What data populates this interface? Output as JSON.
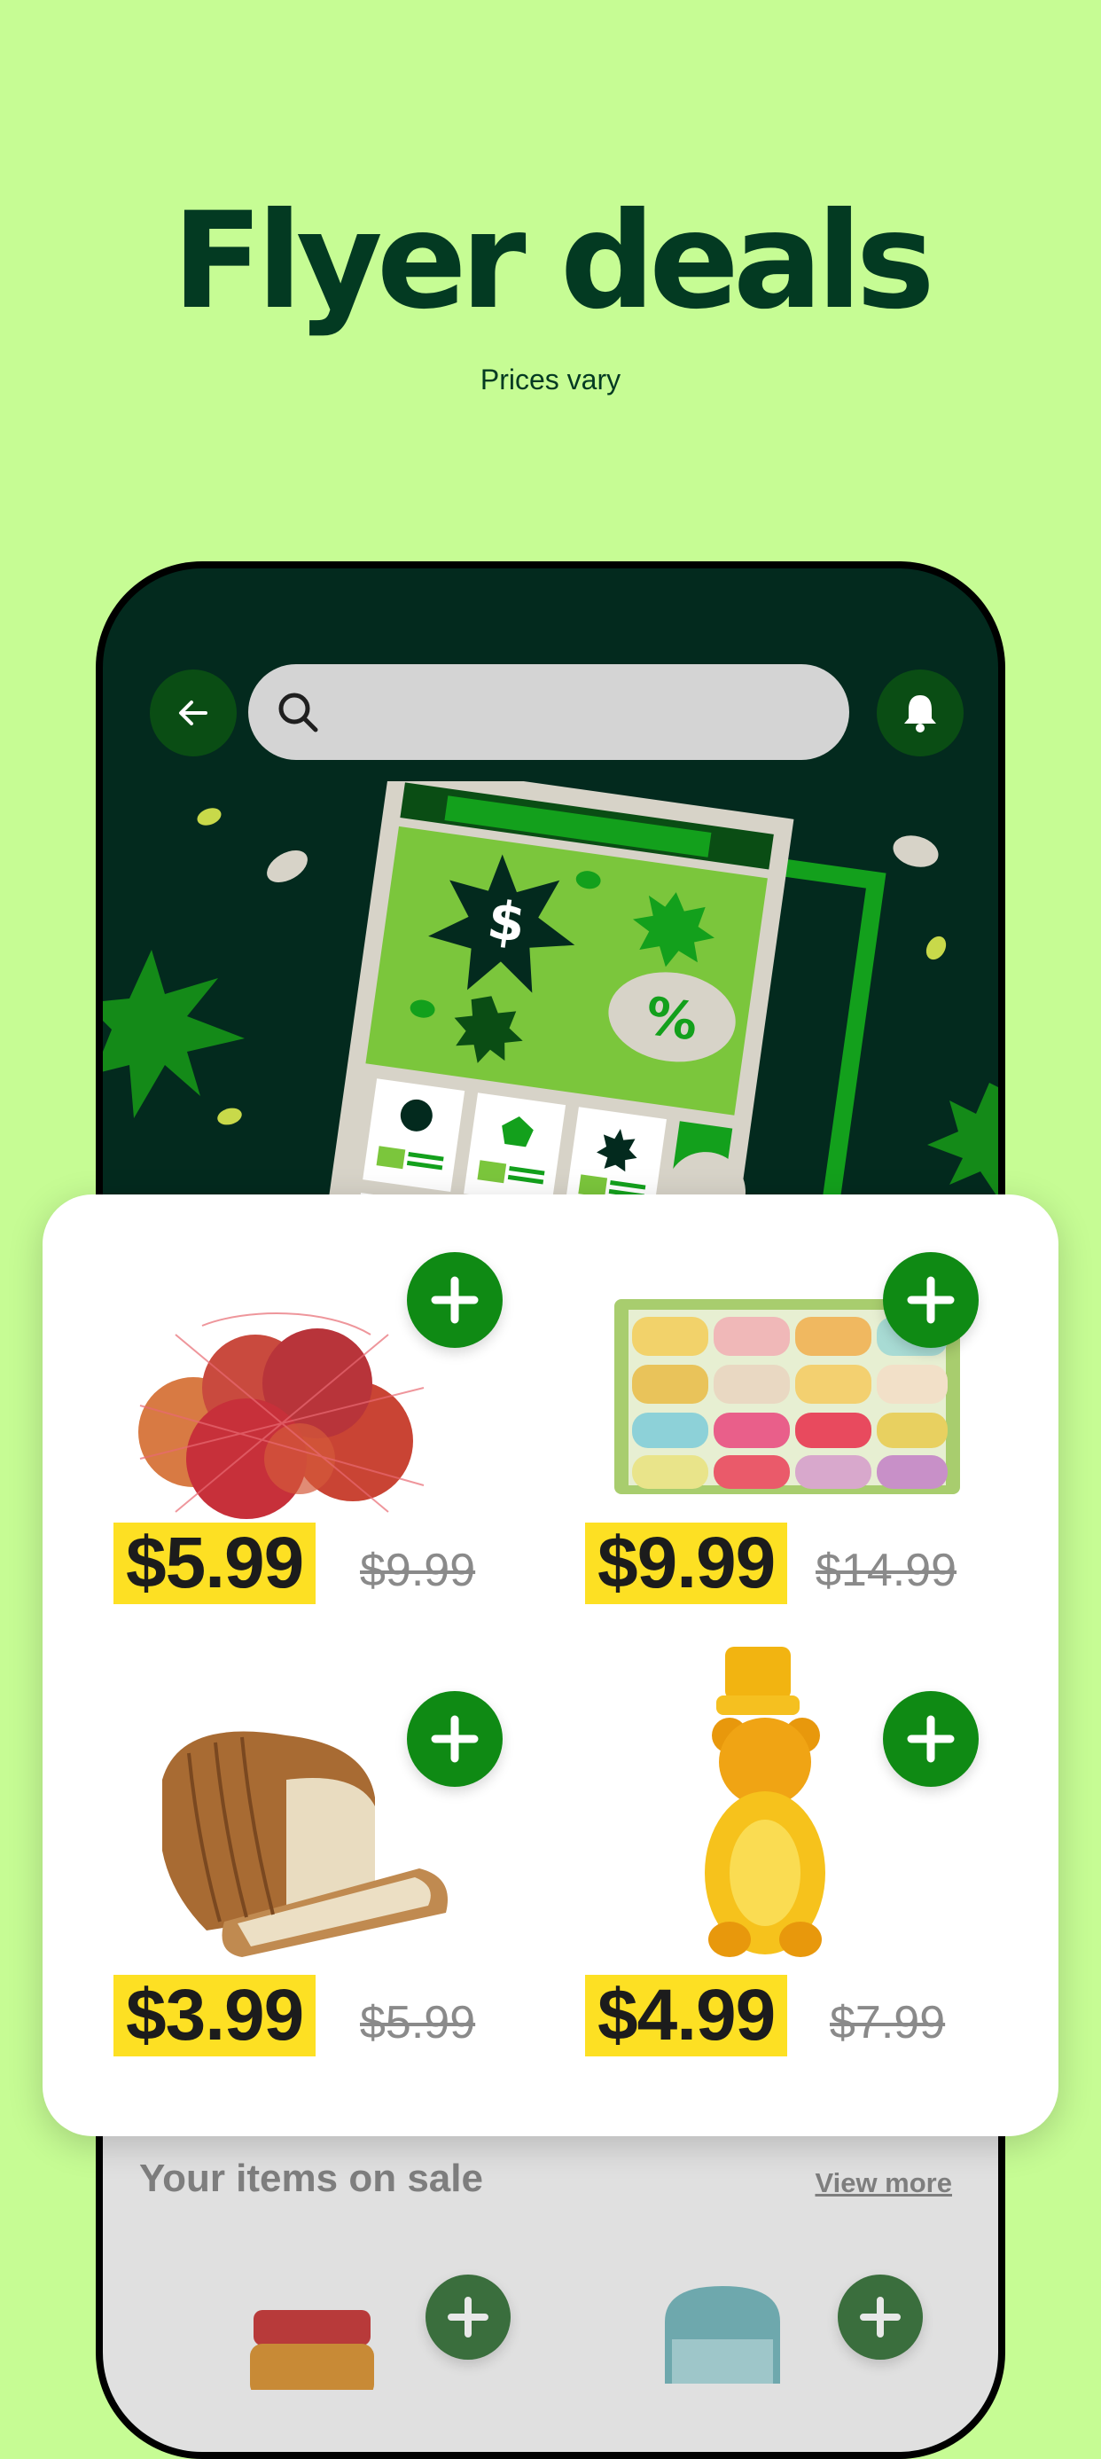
{
  "headline": "Flyer deals",
  "subline": "Prices vary",
  "colors": {
    "background": "#c6fc94",
    "heading": "#033a22",
    "phone_screen": "#032a1e",
    "add_button": "#0f8a14",
    "price_highlight": "#fde023"
  },
  "phone_header": {
    "back_icon": "arrow-left-icon",
    "search_icon": "search-icon",
    "notification_icon": "bell-icon"
  },
  "flyer_illustration": {
    "dollar_symbol": "$",
    "percent_symbol": "%"
  },
  "deals": [
    {
      "product": "apples-in-mesh-bag",
      "price": "$5.99",
      "original_price": "$9.99"
    },
    {
      "product": "box-of-macarons",
      "price": "$9.99",
      "original_price": "$14.99"
    },
    {
      "product": "sliced-bread-loaf",
      "price": "$3.99",
      "original_price": "$5.99"
    },
    {
      "product": "honey-bear-bottle",
      "price": "$4.99",
      "original_price": "$7.99"
    }
  ],
  "add_icon": "plus-icon",
  "sale_section": {
    "title": "Your items on sale",
    "view_more": "View more"
  }
}
